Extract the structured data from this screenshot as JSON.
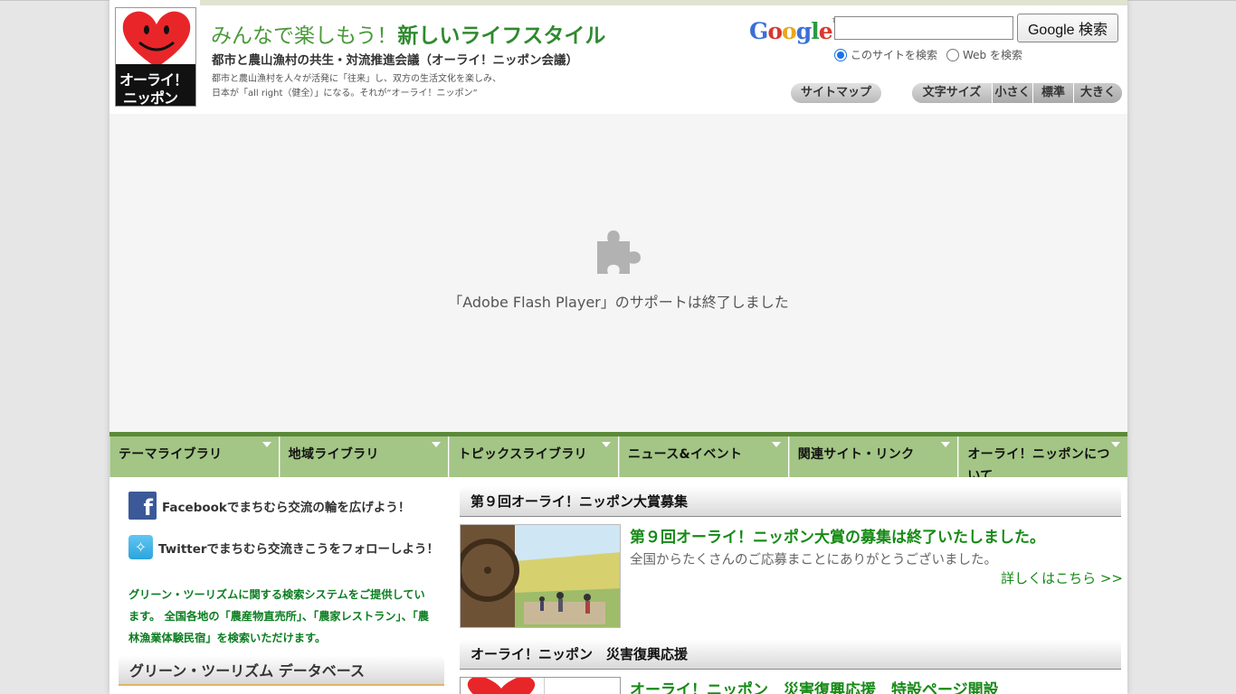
{
  "header": {
    "logo": {
      "line1": "オーライ！",
      "line2": "ニッポン",
      "heart_color": "#e8262a"
    },
    "tagline_part1": "みんなで楽しもう！",
    "tagline_part2": "新しいライフスタイル",
    "org_name": "都市と農山漁村の共生・対流推進会議（オーライ！ニッポン会議）",
    "description_line1": "都市と農山漁村を人々が活発に「往来」し、双方の生活文化を楽しみ、",
    "description_line2": "日本が「all right（健全）」になる。それが“オーライ！ニッポン”"
  },
  "search": {
    "google_logo": "Google",
    "placeholder": "",
    "button_label": "Google 検索",
    "option_site": "このサイトを検索",
    "option_web": "Web を検索",
    "selected": "site"
  },
  "utility": {
    "sitemap_label": "サイトマップ",
    "fontsize_label": "文字サイズ",
    "fontsize_small": "小さく",
    "fontsize_normal": "標準",
    "fontsize_large": "大きく"
  },
  "flash": {
    "icon": "puzzle-piece-icon",
    "message": "「Adobe Flash Player」のサポートは終了しました"
  },
  "nav": {
    "items": [
      {
        "label": "テーマライブラリ"
      },
      {
        "label": "地域ライブラリ"
      },
      {
        "label": "トピックスライブラリ"
      },
      {
        "label": "ニュース&イベント"
      },
      {
        "label": "関連サイト・リンク"
      },
      {
        "label": "オーライ！ニッポンについて"
      }
    ]
  },
  "sidebar": {
    "facebook_text": "Facebookでまちむら交流の輪を広げよう！",
    "twitter_text": "Twitterでまちむら交流きこうをフォローしよう！",
    "gt_description": "グリーン・ツーリズムに関する検索システムをご提供しています。 全国各地の「農産物直売所」、「農家レストラン」、「農林漁業体験民宿」を検索いただけます。",
    "db_header": "グリーン・ツーリズム データベース"
  },
  "main": {
    "award_section_title": "第９回オーライ！ニッポン大賞募集",
    "award_headline": "第９回オーライ！ニッポン大賞の募集は終了いたしました。",
    "award_text": "全国からたくさんのご応募まことにありがとうございました。",
    "award_more": "詳しくはこちら >>",
    "disaster_section_title": "オーライ！ニッポン　災害復興応援",
    "disaster_headline": "オーライ！ニッポン　災害復興応援　特設ページ開設"
  },
  "colors": {
    "nav_green": "#a3c585",
    "nav_dark_green": "#5a8a37",
    "headline_green": "#168a16",
    "tagline_green": "#4b9a3b"
  }
}
